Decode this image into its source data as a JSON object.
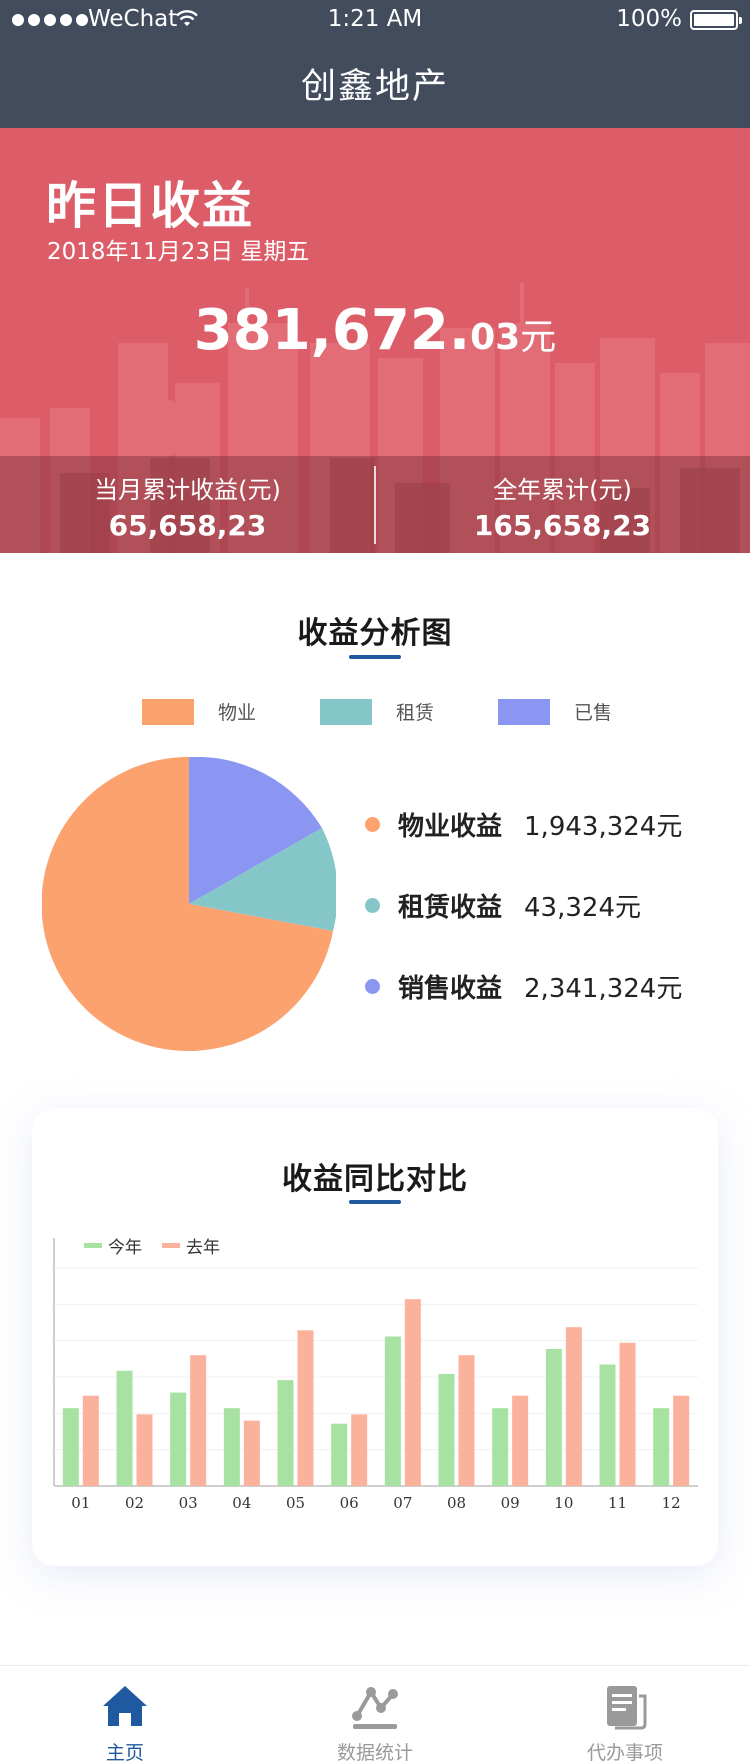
{
  "status_bar": {
    "carrier": "WeChat",
    "time": "1:21 AM",
    "battery": "100%"
  },
  "nav": {
    "title": "创鑫地产"
  },
  "hero": {
    "title": "昨日收益",
    "date": "2018年11月23日 星期五",
    "amount_main": "381,672.",
    "amount_cents": "03",
    "amount_unit": "元",
    "month_label": "当月累计收益(元)",
    "month_value": "65,658,23",
    "year_label": "全年累计(元)",
    "year_value": "165,658,23"
  },
  "pie_section": {
    "title": "收益分析图",
    "legend": [
      {
        "label": "物业",
        "color": "#fca26e"
      },
      {
        "label": "租赁",
        "color": "#85c7c8"
      },
      {
        "label": "已售",
        "color": "#8b96f3"
      }
    ],
    "rows": [
      {
        "name": "物业收益",
        "value": "1,943,324元",
        "color": "#fca26e"
      },
      {
        "name": "租赁收益",
        "value": "43,324元",
        "color": "#85c7c8"
      },
      {
        "name": "销售收益",
        "value": "2,341,324元",
        "color": "#8b96f3"
      }
    ]
  },
  "chart_data": {
    "type": "bar",
    "title": "收益同比对比",
    "categories": [
      "01",
      "02",
      "03",
      "04",
      "05",
      "06",
      "07",
      "08",
      "09",
      "10",
      "11",
      "12"
    ],
    "series": [
      {
        "name": "今年",
        "color": "#a8e2a2",
        "values": [
          25,
          37,
          30,
          25,
          34,
          20,
          48,
          36,
          25,
          44,
          39,
          25
        ]
      },
      {
        "name": "去年",
        "color": "#fbb29c",
        "values": [
          29,
          23,
          42,
          21,
          50,
          23,
          60,
          42,
          29,
          51,
          46,
          29
        ]
      }
    ],
    "ylim": [
      0,
      70
    ],
    "grid": true,
    "legend_position": "top-left"
  },
  "tabbar": {
    "items": [
      {
        "label": "主页",
        "icon": "home-icon",
        "active": true
      },
      {
        "label": "数据统计",
        "icon": "stats-icon",
        "active": false
      },
      {
        "label": "代办事项",
        "icon": "todo-icon",
        "active": false
      }
    ],
    "active_color": "#1f5aa0",
    "inactive_color": "#9a9a9a"
  }
}
